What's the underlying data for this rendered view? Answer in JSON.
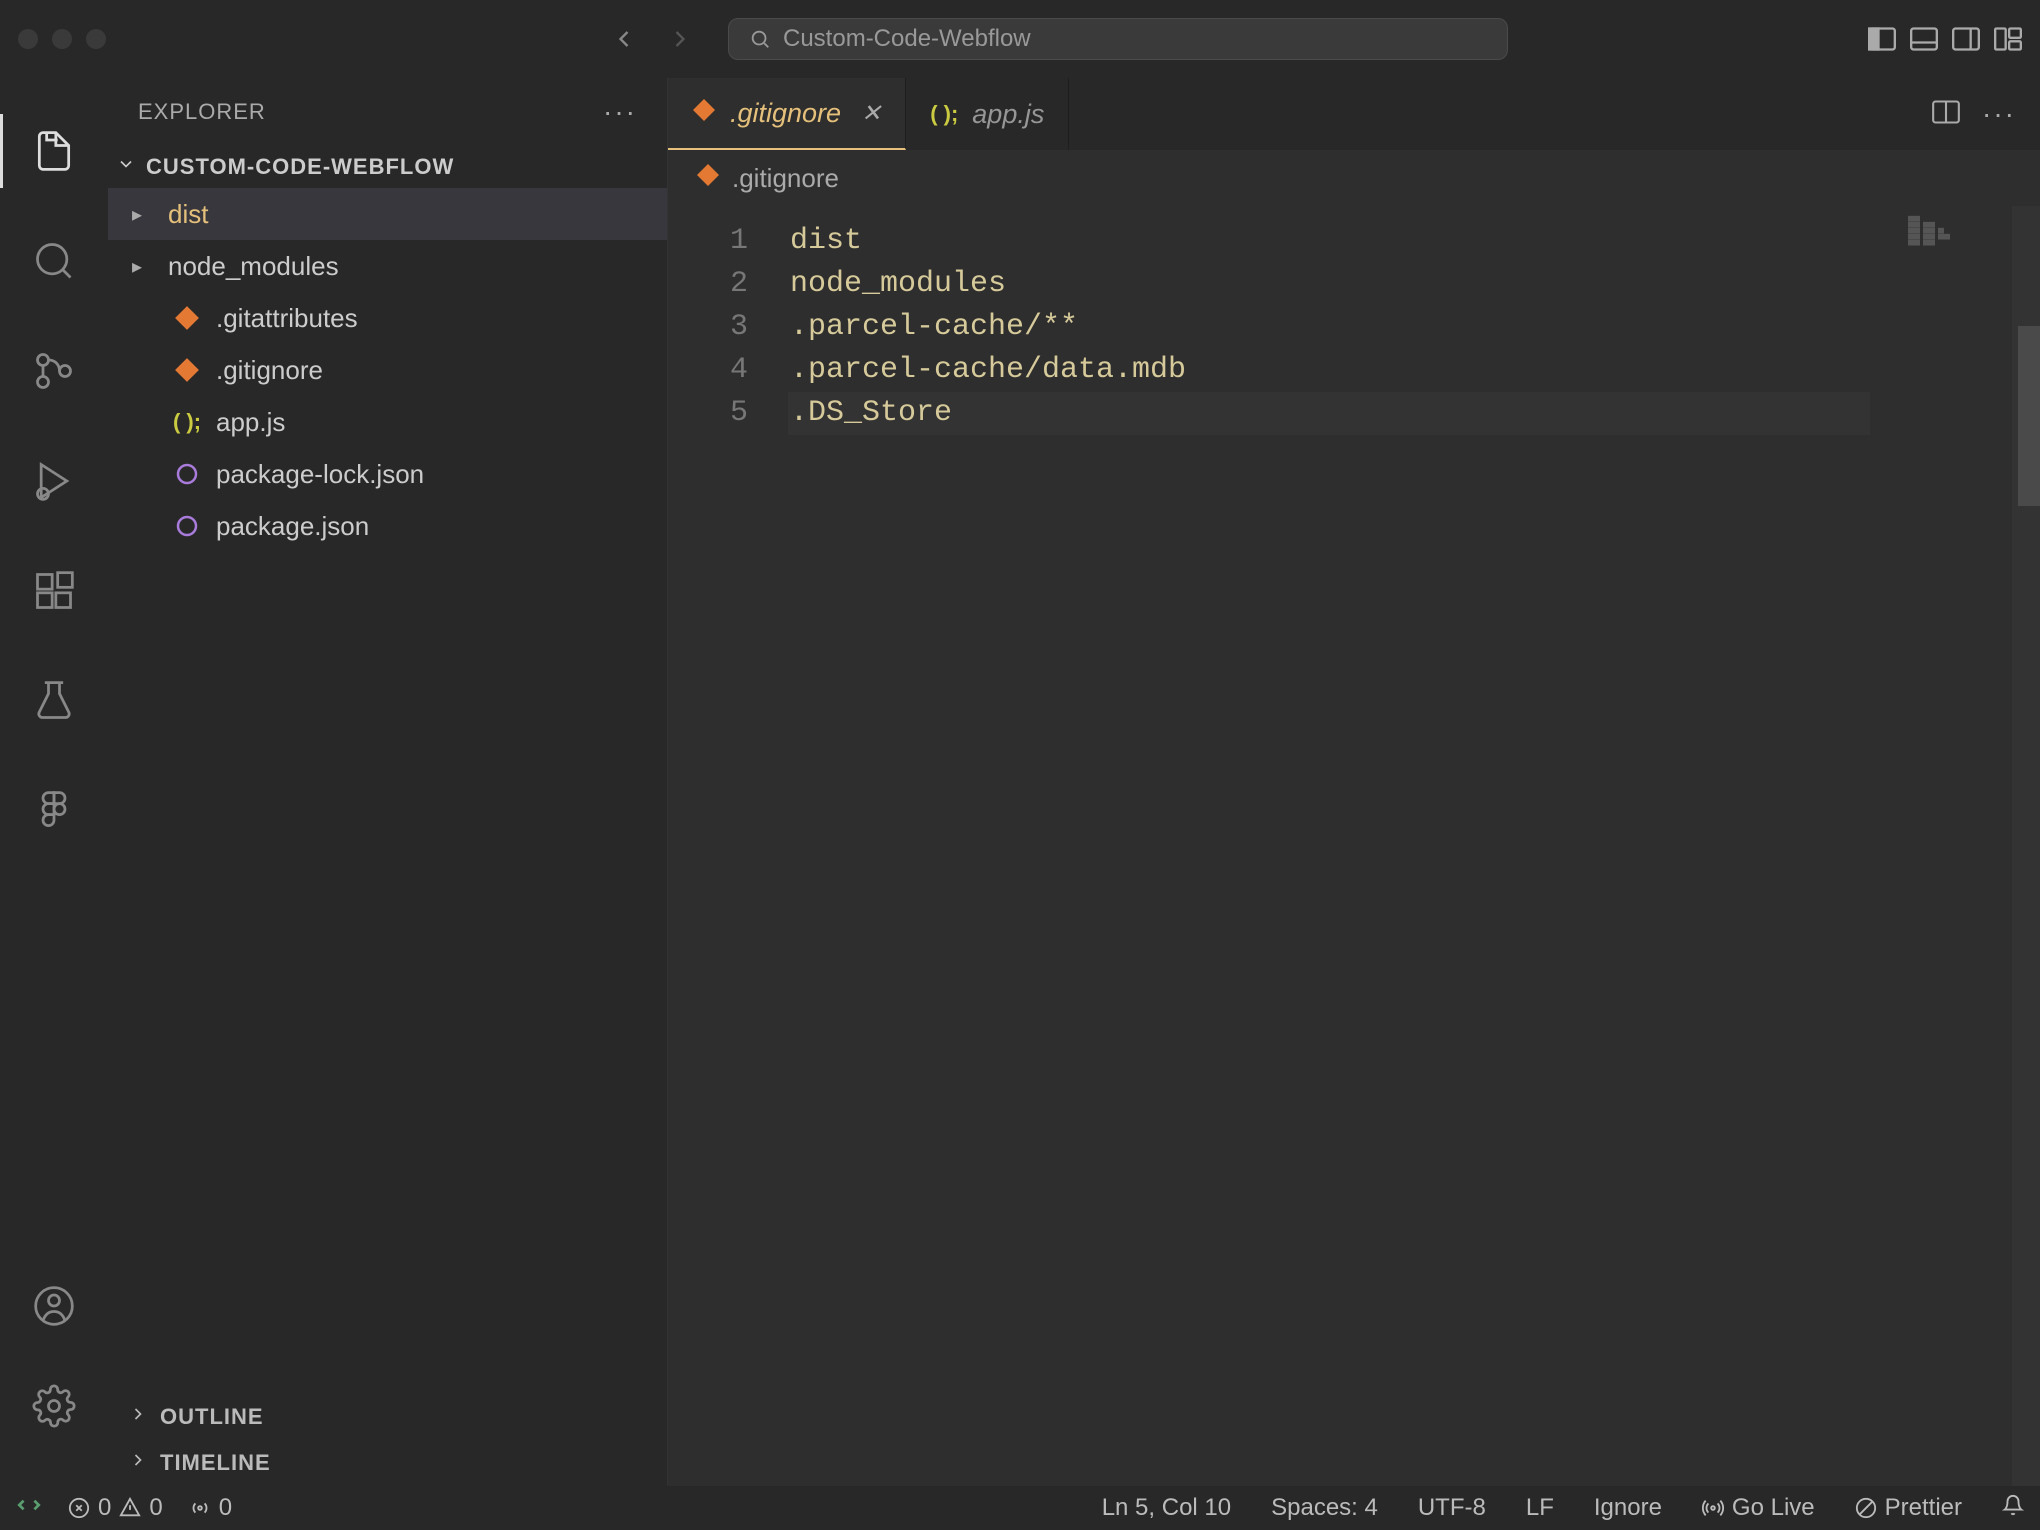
{
  "window": {
    "search_text": "Custom-Code-Webflow"
  },
  "sidebar": {
    "title": "EXPLORER",
    "project": "CUSTOM-CODE-WEBFLOW",
    "tree": [
      {
        "label": "dist",
        "type": "folder"
      },
      {
        "label": "node_modules",
        "type": "folder"
      },
      {
        "label": ".gitattributes",
        "type": "git"
      },
      {
        "label": ".gitignore",
        "type": "git"
      },
      {
        "label": "app.js",
        "type": "js"
      },
      {
        "label": "package-lock.json",
        "type": "json"
      },
      {
        "label": "package.json",
        "type": "json"
      }
    ],
    "outline": "OUTLINE",
    "timeline": "TIMELINE"
  },
  "tabs": [
    {
      "label": ".gitignore",
      "type": "git",
      "active": true
    },
    {
      "label": "app.js",
      "type": "js",
      "active": false
    }
  ],
  "breadcrumb": {
    "file": ".gitignore"
  },
  "editor": {
    "lines": [
      "dist",
      "node_modules",
      ".parcel-cache/**",
      ".parcel-cache/data.mdb",
      ".DS_Store"
    ],
    "current_line_index": 4
  },
  "status": {
    "errors": "0",
    "warnings": "0",
    "ports": "0",
    "cursor": "Ln 5, Col 10",
    "spaces": "Spaces: 4",
    "encoding": "UTF-8",
    "eol": "LF",
    "lang": "Ignore",
    "golive": "Go Live",
    "prettier": "Prettier"
  }
}
